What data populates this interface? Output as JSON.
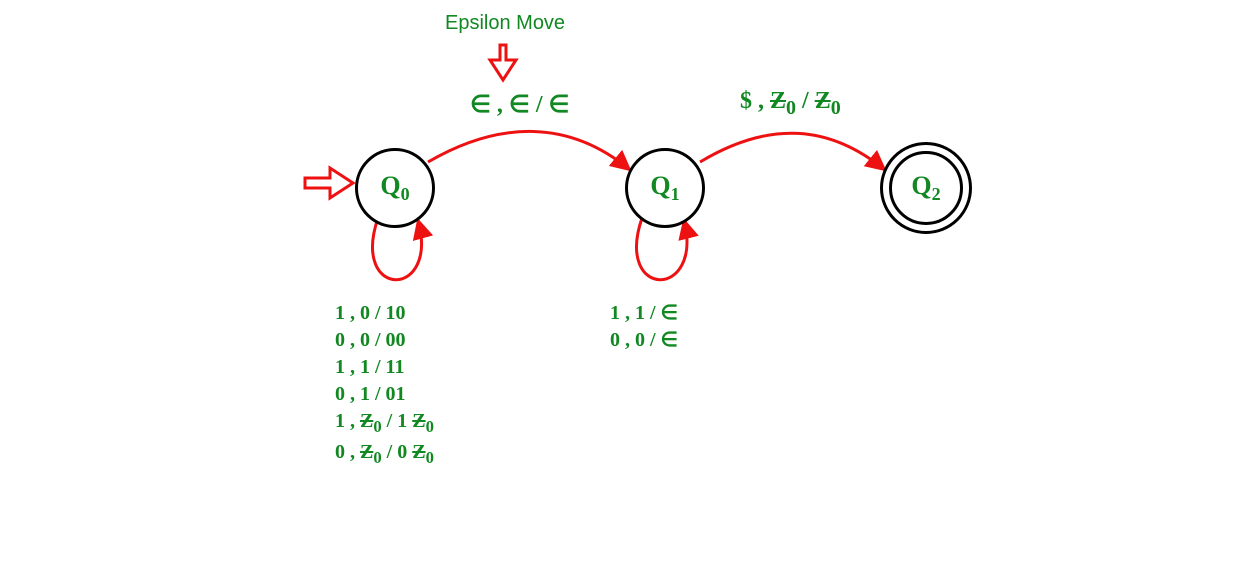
{
  "diagram": {
    "caption": "Epsilon Move",
    "states": {
      "q0": {
        "label": "Q",
        "sub": "0"
      },
      "q1": {
        "label": "Q",
        "sub": "1"
      },
      "q2": {
        "label": "Q",
        "sub": "2"
      }
    },
    "edge_labels": {
      "q0_q1": "∈ , ∈ / ∈",
      "q1_q2_pre": "$ , ",
      "q1_q2_z": "Z",
      "q1_q2_zsub": "0",
      "q1_q2_mid": " / ",
      "q1_q2_z2": "Z",
      "q1_q2_z2sub": "0",
      "q0_loop": [
        "1 , 0  / 10",
        "0 , 0 / 00",
        "1 , 1 / 11",
        "0 , 1 / 01"
      ],
      "q0_loop_zlines": [
        {
          "pre": "1 , ",
          "za": "Z",
          "zas": "0",
          "mid": " / 1 ",
          "zb": "Z",
          "zbs": "0"
        },
        {
          "pre": "0 , ",
          "za": "Z",
          "zas": "0",
          "mid": " / 0 ",
          "zb": "Z",
          "zbs": "0"
        }
      ],
      "q1_loop": [
        "1 , 1 / ∈",
        "0 , 0 / ∈"
      ]
    }
  }
}
